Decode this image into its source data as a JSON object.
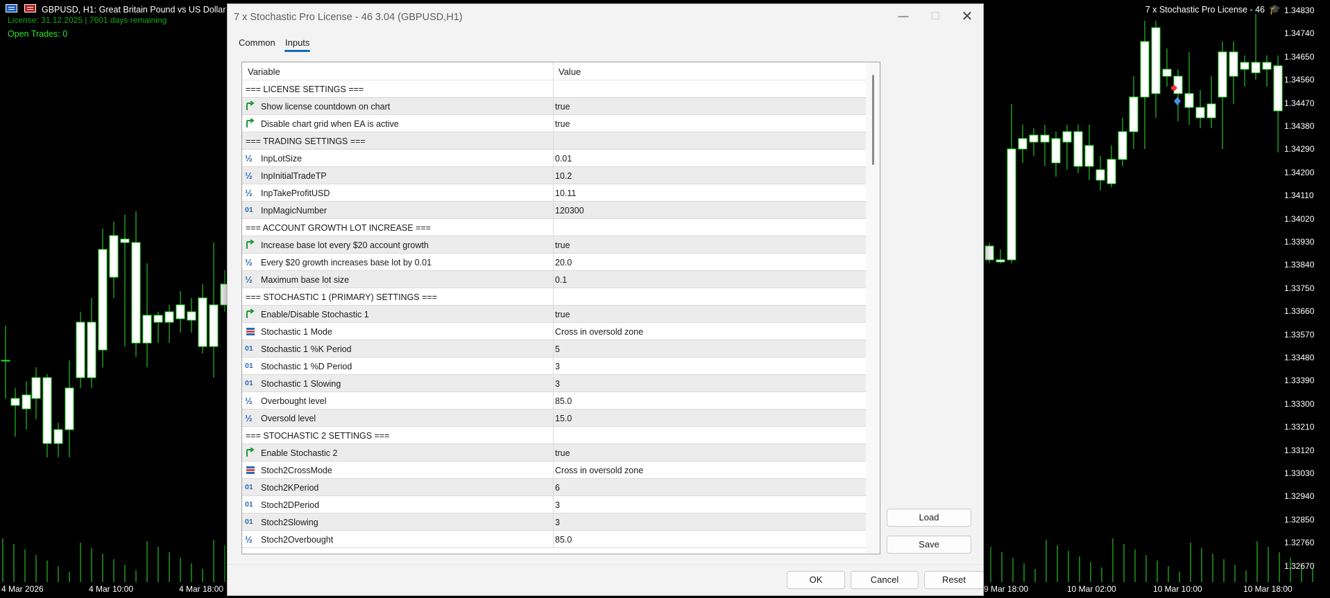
{
  "chart": {
    "symbol_title": "GBPUSD, H1:  Great Britain Pound vs US Dollar",
    "license_line": "License: 31.12.2025 | 7601 days remaining",
    "open_trades": "Open Trades: 0",
    "ea_name": "7 x Stochastic Pro License - 46",
    "price_axis": [
      "1.34830",
      "1.34740",
      "1.34650",
      "1.34560",
      "1.34470",
      "1.34380",
      "1.34290",
      "1.34200",
      "1.34110",
      "1.34020",
      "1.33930",
      "1.33840",
      "1.33750",
      "1.33660",
      "1.33570",
      "1.33480",
      "1.33390",
      "1.33300",
      "1.33210",
      "1.33120",
      "1.33030",
      "1.32940",
      "1.32850",
      "1.32760",
      "1.32670"
    ],
    "time_axis": [
      "4 Mar 2026",
      "4 Mar 10:00",
      "4 Mar 18:00",
      "9 Mar 18:00",
      "10 Mar 02:00",
      "10 Mar 10:00",
      "10 Mar 18:00"
    ],
    "colors": {
      "bull": "#ffffff",
      "wick": "#2ee62e",
      "volume": "#2ee62e",
      "text_green": "#29e629"
    }
  },
  "dialog": {
    "title": "7 x Stochastic Pro License - 46 3.04 (GBPUSD,H1)",
    "tabs": [
      {
        "label": "Common"
      },
      {
        "label": "Inputs"
      }
    ],
    "columns": {
      "variable": "Variable",
      "value": "Value"
    },
    "rows": [
      {
        "type": "section",
        "variable": "=== LICENSE SETTINGS ===",
        "value": ""
      },
      {
        "type": "bool",
        "variable": "Show license countdown on chart",
        "value": "true"
      },
      {
        "type": "bool",
        "variable": "Disable chart grid when EA is active",
        "value": "true"
      },
      {
        "type": "section",
        "variable": "=== TRADING SETTINGS ===",
        "value": ""
      },
      {
        "type": "double",
        "variable": "InpLotSize",
        "value": "0.01"
      },
      {
        "type": "double",
        "variable": "InpInitialTradeTP",
        "value": "10.2"
      },
      {
        "type": "double",
        "variable": "InpTakeProfitUSD",
        "value": "10.11"
      },
      {
        "type": "int",
        "variable": "InpMagicNumber",
        "value": "120300"
      },
      {
        "type": "section",
        "variable": "=== ACCOUNT GROWTH LOT INCREASE ===",
        "value": ""
      },
      {
        "type": "bool",
        "variable": "Increase base lot every $20 account growth",
        "value": "true"
      },
      {
        "type": "double",
        "variable": "Every $20 growth increases base lot by 0.01",
        "value": "20.0"
      },
      {
        "type": "double",
        "variable": "Maximum base lot size",
        "value": "0.1"
      },
      {
        "type": "section",
        "variable": "=== STOCHASTIC 1 (PRIMARY) SETTINGS ===",
        "value": ""
      },
      {
        "type": "bool",
        "variable": "Enable/Disable Stochastic 1",
        "value": "true"
      },
      {
        "type": "enum",
        "variable": "Stochastic 1 Mode",
        "value": "Cross in oversold zone"
      },
      {
        "type": "int",
        "variable": "Stochastic 1 %K Period",
        "value": "5"
      },
      {
        "type": "int",
        "variable": "Stochastic 1 %D Period",
        "value": "3"
      },
      {
        "type": "int",
        "variable": "Stochastic 1 Slowing",
        "value": "3"
      },
      {
        "type": "double",
        "variable": "Overbought level",
        "value": "85.0"
      },
      {
        "type": "double",
        "variable": "Oversold level",
        "value": "15.0"
      },
      {
        "type": "section",
        "variable": "=== STOCHASTIC 2 SETTINGS ===",
        "value": ""
      },
      {
        "type": "bool",
        "variable": "Enable Stochastic 2",
        "value": "true"
      },
      {
        "type": "enum",
        "variable": "Stoch2CrossMode",
        "value": "Cross in oversold zone"
      },
      {
        "type": "int",
        "variable": "Stoch2KPeriod",
        "value": "6"
      },
      {
        "type": "int",
        "variable": "Stoch2DPeriod",
        "value": "3"
      },
      {
        "type": "int",
        "variable": "Stoch2Slowing",
        "value": "3"
      },
      {
        "type": "double",
        "variable": "Stoch2Overbought",
        "value": "85.0"
      }
    ],
    "icons": {
      "bool": "bool-flag-icon",
      "double": "double-fraction-icon",
      "int": "integer-01-icon",
      "enum": "enum-list-icon"
    },
    "icon_glyphs": {
      "double": "½",
      "int": "01"
    },
    "buttons": {
      "load": "Load",
      "save": "Save",
      "ok": "OK",
      "cancel": "Cancel",
      "reset": "Reset"
    },
    "window_buttons": {
      "minimize": "—",
      "maximize": "☐",
      "close": "✕"
    }
  }
}
